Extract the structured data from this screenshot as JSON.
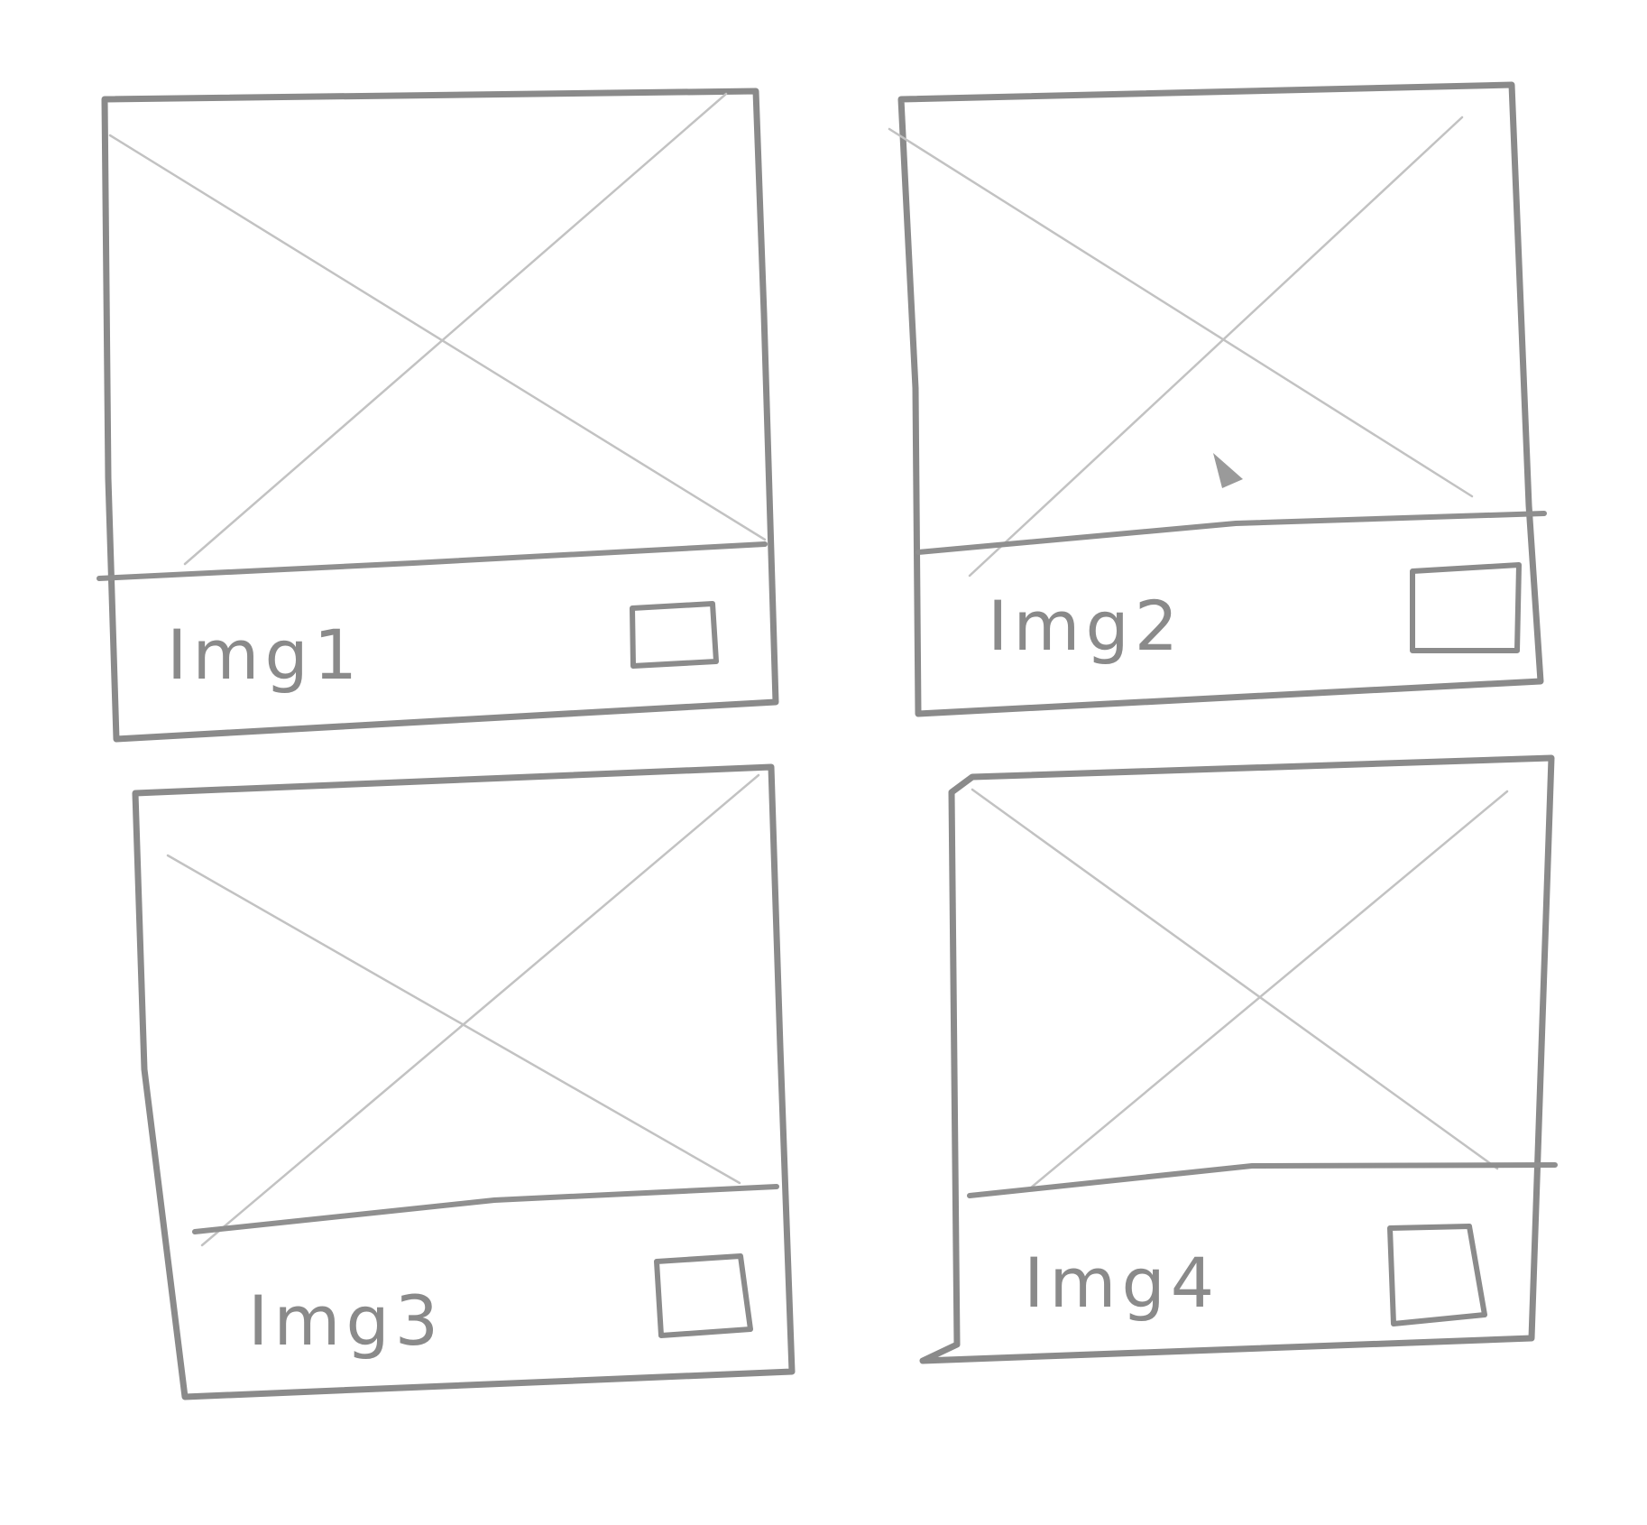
{
  "gallery": {
    "cards": [
      {
        "label": "Img1",
        "selected": false
      },
      {
        "label": "Img2",
        "selected": false
      },
      {
        "label": "Img3",
        "selected": false
      },
      {
        "label": "Img4",
        "selected": false
      }
    ]
  },
  "colors": {
    "pencil": "#8a8a8a",
    "light_pencil": "#c2c2c2",
    "paper": "#ffffff"
  }
}
